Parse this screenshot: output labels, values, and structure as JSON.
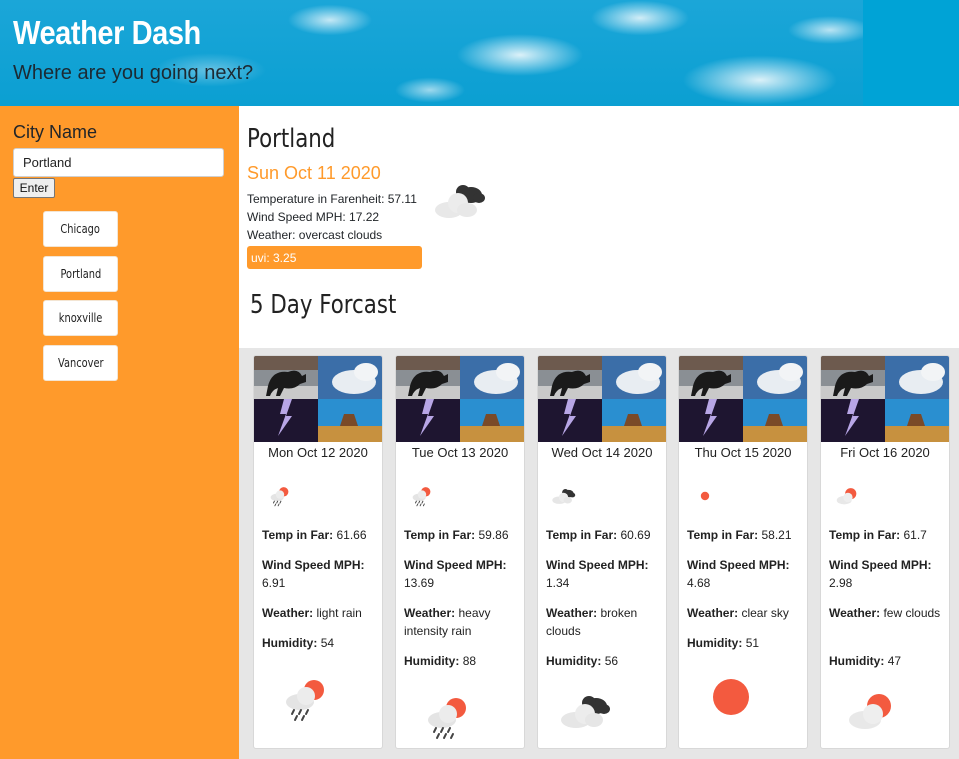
{
  "header": {
    "title": "Weather Dash",
    "subtitle": "Where are you going next?"
  },
  "sidebar": {
    "label": "City Name",
    "input_value": "Portland",
    "enter_label": "Enter",
    "history": [
      "Chicago",
      "Portland",
      "knoxville",
      "Vancover"
    ]
  },
  "current": {
    "city": "Portland",
    "date": "Sun Oct 11 2020",
    "temp_line": "Temperature in Farenheit: 57.11",
    "wind_line": "Wind Speed MPH: 17.22",
    "weather_line": "Weather: overcast clouds",
    "uvi_line": "uvi: 3.25",
    "icon": "overcast-clouds-icon"
  },
  "forecast": {
    "title": "5 Day Forcast",
    "labels": {
      "temp": "Temp in Far:",
      "wind": "Wind Speed MPH:",
      "weather": "Weather:",
      "humidity": "Humidity:"
    },
    "days": [
      {
        "date": "Mon Oct 12 2020",
        "temp": "61.66",
        "wind": "6.91",
        "weather": "light rain",
        "humidity": "54",
        "icon": "light-rain-icon"
      },
      {
        "date": "Tue Oct 13 2020",
        "temp": "59.86",
        "wind": "13.69",
        "weather": "heavy intensity rain",
        "humidity": "88",
        "icon": "heavy-rain-icon"
      },
      {
        "date": "Wed Oct 14 2020",
        "temp": "60.69",
        "wind": "1.34",
        "weather": "broken clouds",
        "humidity": "56",
        "icon": "broken-clouds-icon"
      },
      {
        "date": "Thu Oct 15 2020",
        "temp": "58.21",
        "wind": "4.68",
        "weather": "clear sky",
        "humidity": "51",
        "icon": "clear-sky-icon"
      },
      {
        "date": "Fri Oct 16 2020",
        "temp": "61.7",
        "wind": "2.98",
        "weather": "few clouds",
        "humidity": "47",
        "icon": "few-clouds-icon"
      }
    ]
  },
  "colors": {
    "accent": "#ff9a2b",
    "header_sky": "#00a3d6",
    "sun": "#f35a3f"
  }
}
